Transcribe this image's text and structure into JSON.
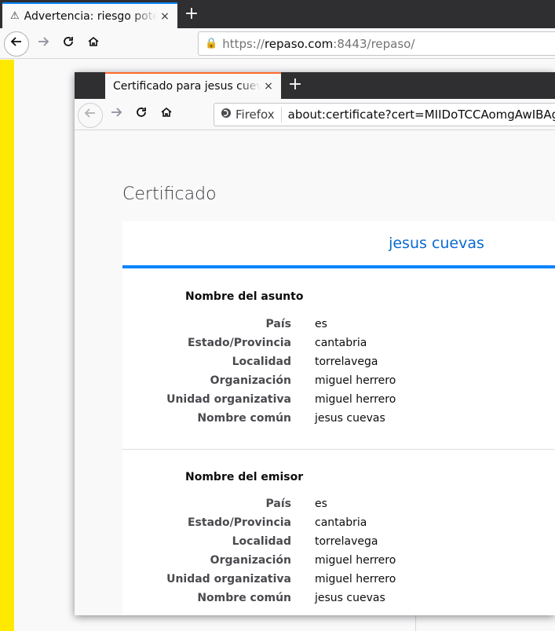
{
  "outer": {
    "tab_title": "Advertencia: riesgo potencial",
    "tab_close": "×",
    "new_tab": "+",
    "url_scheme": "https://",
    "url_host": "repaso.com",
    "url_port_path": ":8443/repaso/"
  },
  "cert_window": {
    "tab_title": "Certificado para jesus cuevas",
    "tab_close": "×",
    "new_tab": "+",
    "identity_label": "Firefox",
    "address": "about:certificate?cert=MIIDoTCCAomgAwIBAgIEDHp"
  },
  "page": {
    "title": "Certificado",
    "common_name_header": "jesus cuevas",
    "subject": {
      "title": "Nombre del asunto",
      "rows": [
        {
          "k": "País",
          "v": "es"
        },
        {
          "k": "Estado/Provincia",
          "v": "cantabria"
        },
        {
          "k": "Localidad",
          "v": "torrelavega"
        },
        {
          "k": "Organización",
          "v": "miguel herrero"
        },
        {
          "k": "Unidad organizativa",
          "v": "miguel herrero"
        },
        {
          "k": "Nombre común",
          "v": "jesus cuevas"
        }
      ]
    },
    "issuer": {
      "title": "Nombre del emisor",
      "rows": [
        {
          "k": "País",
          "v": "es"
        },
        {
          "k": "Estado/Provincia",
          "v": "cantabria"
        },
        {
          "k": "Localidad",
          "v": "torrelavega"
        },
        {
          "k": "Organización",
          "v": "miguel herrero"
        },
        {
          "k": "Unidad organizativa",
          "v": "miguel herrero"
        },
        {
          "k": "Nombre común",
          "v": "jesus cuevas"
        }
      ]
    }
  },
  "colors": {
    "accent_blue": "#0a84ff",
    "cert_tab_accent": "#ff6a2d",
    "left_strip": "#ffe900"
  },
  "icons": {
    "warning": "warning-icon",
    "back": "back-arrow-icon",
    "forward": "forward-arrow-icon",
    "reload": "reload-icon",
    "home": "home-icon",
    "lock_warning": "lock-warning-icon",
    "firefox": "firefox-icon"
  }
}
